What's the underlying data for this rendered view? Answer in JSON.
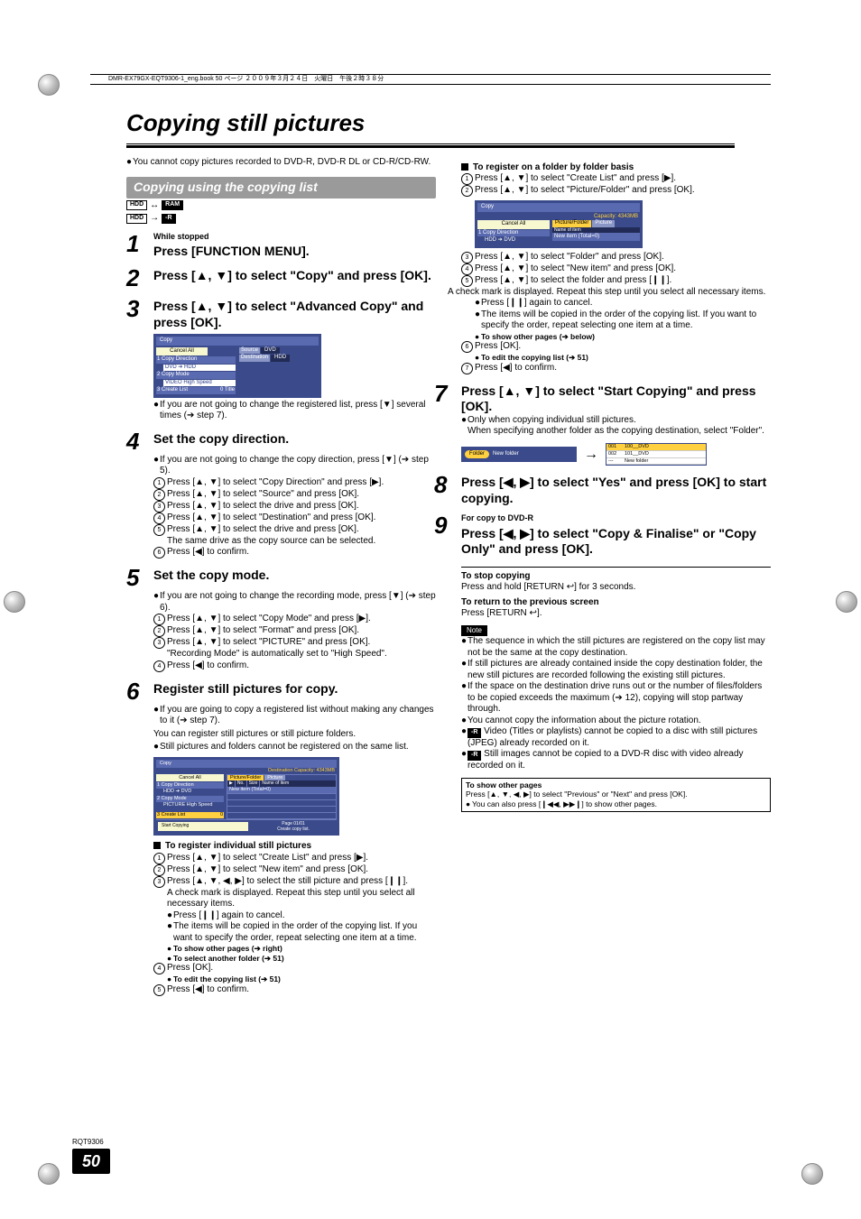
{
  "header": {
    "top_info": "DMR-EX79GX-EQT9306-1_eng.book   50 ページ   ２００９年３月２４日　火曜日　午後２時３８分"
  },
  "title": "Copying still pictures",
  "intro_bullet": "You cannot copy pictures recorded to DVD-R, DVD-R DL or CD-R/CD-RW.",
  "section_bar": "Copying using the copying list",
  "badges": {
    "hdd": "HDD",
    "arrow1": "↔",
    "ram": "RAM",
    "arrow2": "→",
    "r": "-R"
  },
  "step1": {
    "small": "While stopped",
    "action": "Press [FUNCTION MENU]."
  },
  "step2": {
    "action": "Press [▲, ▼] to select \"Copy\" and press [OK]."
  },
  "step3": {
    "action": "Press [▲, ▼] to select \"Advanced Copy\" and press [OK].",
    "osd": {
      "title": "Copy",
      "cancel": "Cancel All",
      "row1": "1 Copy Direction",
      "row1b": "DVD ➔ HDD",
      "row2": "2 Copy Mode",
      "row2b": "VIDEO  High Speed",
      "row3": "3 Create List",
      "row3b": "0 Title",
      "src_lbl": "Source",
      "src_val": "DVD",
      "dst_lbl": "Destination",
      "dst_val": "HDD"
    },
    "note": "If you are not going to change the registered list, press [▼] several times (➔ step 7)."
  },
  "step4": {
    "action": "Set the copy direction.",
    "pre": "If you are not going to change the copy direction, press [▼] (➔ step 5).",
    "l1": "Press [▲, ▼] to select \"Copy Direction\" and press [▶].",
    "l2": "Press [▲, ▼] to select \"Source\" and press [OK].",
    "l3": "Press [▲, ▼] to select the drive and press [OK].",
    "l4": "Press [▲, ▼] to select \"Destination\" and press [OK].",
    "l5": "Press [▲, ▼] to select the drive and press [OK].",
    "l5b": "The same drive as the copy source can be selected.",
    "l6": "Press [◀] to confirm."
  },
  "step5": {
    "action": "Set the copy mode.",
    "pre": "If you are not going to change the recording mode, press [▼] (➔ step 6).",
    "l1": "Press [▲, ▼] to select \"Copy Mode\" and press [▶].",
    "l2": "Press [▲, ▼] to select \"Format\" and press [OK].",
    "l3": "Press [▲, ▼] to select \"PICTURE\" and press [OK].",
    "l3b": "\"Recording Mode\" is automatically set to \"High Speed\".",
    "l4": "Press [◀] to confirm."
  },
  "step6": {
    "action": "Register still pictures for copy.",
    "pre": "If you are going to copy a registered list without making any changes to it (➔ step 7).",
    "t1": "You can register still pictures or still picture folders.",
    "t2": "Still pictures and folders cannot be registered on the same list.",
    "osd": {
      "title": "Copy",
      "cap": "Destination Capacity: 4343MB",
      "cancel": "Cancel All",
      "row1": "1 Copy Direction",
      "row1b": "HDD ➔ DVD",
      "row2": "2 Copy Mode",
      "row2b": "PICTURE  High Speed",
      "row3": "3 Create List",
      "row3b": "0",
      "tab1": "Picture/Folder",
      "tab2": "Picture",
      "th1": "No.",
      "th2": "Size",
      "th3": "Name of item",
      "newitem": "New item (Total=0)",
      "page": "Page 01/01",
      "create": "Create copy list.",
      "start": "Start Copying"
    }
  },
  "indiv": {
    "head": "To register individual still pictures",
    "l1": "Press [▲, ▼] to select \"Create List\" and press [▶].",
    "l2": "Press [▲, ▼] to select \"New item\" and press [OK].",
    "l3": "Press [▲, ▼, ◀, ▶] to select the still picture and press [❙❙].",
    "l3b": "A check mark is displayed. Repeat this step until you select all necessary items.",
    "b1": "Press [❙❙] again to cancel.",
    "b2": "The items will be copied in the order of the copying list. If you want to specify the order, repeat selecting one item at a time.",
    "b3": "To show other pages (➔ right)",
    "b4": "To select another folder (➔ 51)",
    "l4": "Press [OK].",
    "b5": "To edit the copying list (➔ 51)",
    "l5": "Press [◀] to confirm."
  },
  "folder": {
    "head": "To register on a folder by folder basis",
    "l1": "Press [▲, ▼] to select \"Create List\" and press [▶].",
    "l2": "Press [▲, ▼] to select \"Picture/Folder\" and press [OK].",
    "osd": {
      "title": "Copy",
      "cap": "Capacity: 4343MB",
      "cancel": "Cancel All",
      "row1": "1 Copy Direction",
      "row1b": "HDD ➔ DVD",
      "tab1": "Picture/Folder",
      "tab2": "Picture",
      "th3": "Name of item",
      "newitem": "New item (Total=0)"
    },
    "l3": "Press [▲, ▼] to select \"Folder\" and press [OK].",
    "l4": "Press [▲, ▼] to select \"New item\" and press [OK].",
    "l5": "Press [▲, ▼] to select the folder and press [❙❙].",
    "l5b": "A check mark is displayed. Repeat this step until you select all necessary items.",
    "b1": "Press [❙❙] again to cancel.",
    "b2": "The items will be copied in the order of the copying list. If you want to specify the order, repeat selecting one item at a time.",
    "b3": "To show other pages (➔ below)",
    "l6": "Press [OK].",
    "b4": "To edit the copying list (➔ 51)",
    "l7": "Press [◀] to confirm."
  },
  "step7": {
    "action": "Press [▲, ▼] to select \"Start Copying\" and press [OK].",
    "t1": "Only when copying individual still pictures.",
    "t2": "When specifying another folder as the copying destination, select \"Folder\".",
    "pill_folder": "Folder",
    "pill_new": "New folder",
    "list_r1a": "001",
    "list_r1b": "100__DVD",
    "list_r2a": "002",
    "list_r2b": "101__DVD",
    "list_r3": "New folder"
  },
  "step8": {
    "action": "Press [◀, ▶] to select \"Yes\" and press [OK] to start copying."
  },
  "step9": {
    "small": "For copy to DVD-R",
    "action": "Press [◀, ▶] to select \"Copy & Finalise\" or \"Copy Only\" and press [OK]."
  },
  "stop": {
    "h": "To stop copying",
    "t": "Press and hold [RETURN ↩] for 3 seconds."
  },
  "ret": {
    "h": "To return to the previous screen",
    "t": "Press [RETURN ↩]."
  },
  "note_tag": "Note",
  "notes": {
    "n1": "The sequence in which the still pictures are registered on the copy list may not be the same at the copy destination.",
    "n2": "If still pictures are already contained inside the copy destination folder, the new still pictures are recorded following the existing still pictures.",
    "n3": "If the space on the destination drive runs out or the number of files/folders to be copied exceeds the maximum (➔ 12), copying will stop partway through.",
    "n4": "You cannot copy the information about the picture rotation.",
    "n5a": "-R",
    "n5": " Video (Titles or playlists) cannot be copied to a disc with still pictures (JPEG) already recorded on it.",
    "n6a": "-R",
    "n6": " Still images cannot be copied to a DVD-R disc with video already recorded on it."
  },
  "showbox": {
    "h": "To show other pages",
    "t1": "Press [▲, ▼, ◀, ▶] to select \"Previous\" or \"Next\" and press [OK].",
    "t2": "You can also press [❙◀◀, ▶▶❙] to show other pages."
  },
  "footer": {
    "rqt": "RQT9306",
    "page": "50"
  }
}
